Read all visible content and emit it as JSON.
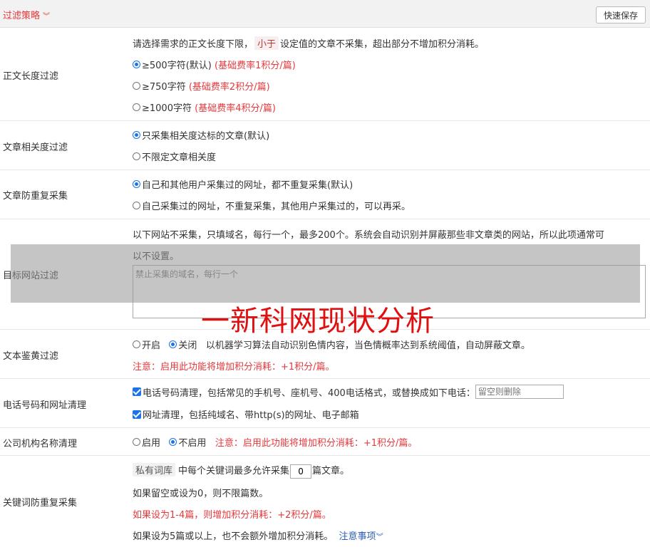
{
  "header": {
    "title": "过滤策略",
    "chevron": "chevron-double-down-icon",
    "save_label": "快速保存"
  },
  "length_filter": {
    "label": "正文长度过滤",
    "desc_pre": "请选择需求的正文长度下限，",
    "desc_tag": "小于",
    "desc_post": "设定值的文章不采集，超出部分不增加积分消耗。",
    "options": [
      {
        "text": "≥500字符(默认)",
        "note": "(基础费率1积分/篇)",
        "selected": true
      },
      {
        "text": "≥750字符",
        "note": "(基础费率2积分/篇)",
        "selected": false
      },
      {
        "text": "≥1000字符",
        "note": "(基础费率4积分/篇)",
        "selected": false
      }
    ]
  },
  "relevance": {
    "label": "文章相关度过滤",
    "options": [
      {
        "text": "只采集相关度达标的文章(默认)",
        "selected": true
      },
      {
        "text": "不限定文章相关度",
        "selected": false
      }
    ]
  },
  "dedupe": {
    "label": "文章防重复采集",
    "options": [
      {
        "text": "自己和其他用户采集过的网址，都不重复采集(默认)",
        "selected": true
      },
      {
        "text": "自己采集过的网址，不重复采集，其他用户采集过的，可以再采。",
        "selected": false
      }
    ]
  },
  "site_filter": {
    "label": "目标网站过滤",
    "desc_line1": "以下网站不采集，只填域名，每行一个，最多200个。系统会自动识别并屏蔽那些非文章类的网站，所以此项通常可",
    "desc_line2": "以不设置。",
    "placeholder": "禁止采集的域名，每行一个"
  },
  "porn_filter": {
    "label": "文本鉴黄过滤",
    "on_label": "开启",
    "off_label": "关闭",
    "desc": "以机器学习算法自动识别色情内容，当色情概率达到系统阈值，自动屏蔽文章。",
    "note": "注意：启用此功能将增加积分消耗：+1积分/篇。"
  },
  "phone_clean": {
    "label": "电话号码和网址清理",
    "phone_text": "电话号码清理，包括常见的手机号、座机号、400电话格式，或替换成如下电话：",
    "phone_placeholder": "留空则删除",
    "url_text": "网址清理，包括纯域名、带http(s)的网址、电子邮箱"
  },
  "company_clean": {
    "label": "公司机构名称清理",
    "on_label": "启用",
    "off_label": "不启用",
    "note": "注意：启用此功能将增加积分消耗：+1积分/篇。"
  },
  "keyword_dedupe": {
    "label": "关键词防重复采集",
    "tag": "私有词库",
    "line1_pre": "中每个关键词最多允许采集",
    "count": "0",
    "line1_post": "篇文章。",
    "line2": "如果留空或设为0，则不限篇数。",
    "line3": "如果设为1-4篇，则增加积分消耗：+2积分/篇。",
    "line4": "如果设为5篇或以上，也不会额外增加积分消耗。",
    "notice_link": "注意事项"
  },
  "watermark": "一新科网现状分析"
}
